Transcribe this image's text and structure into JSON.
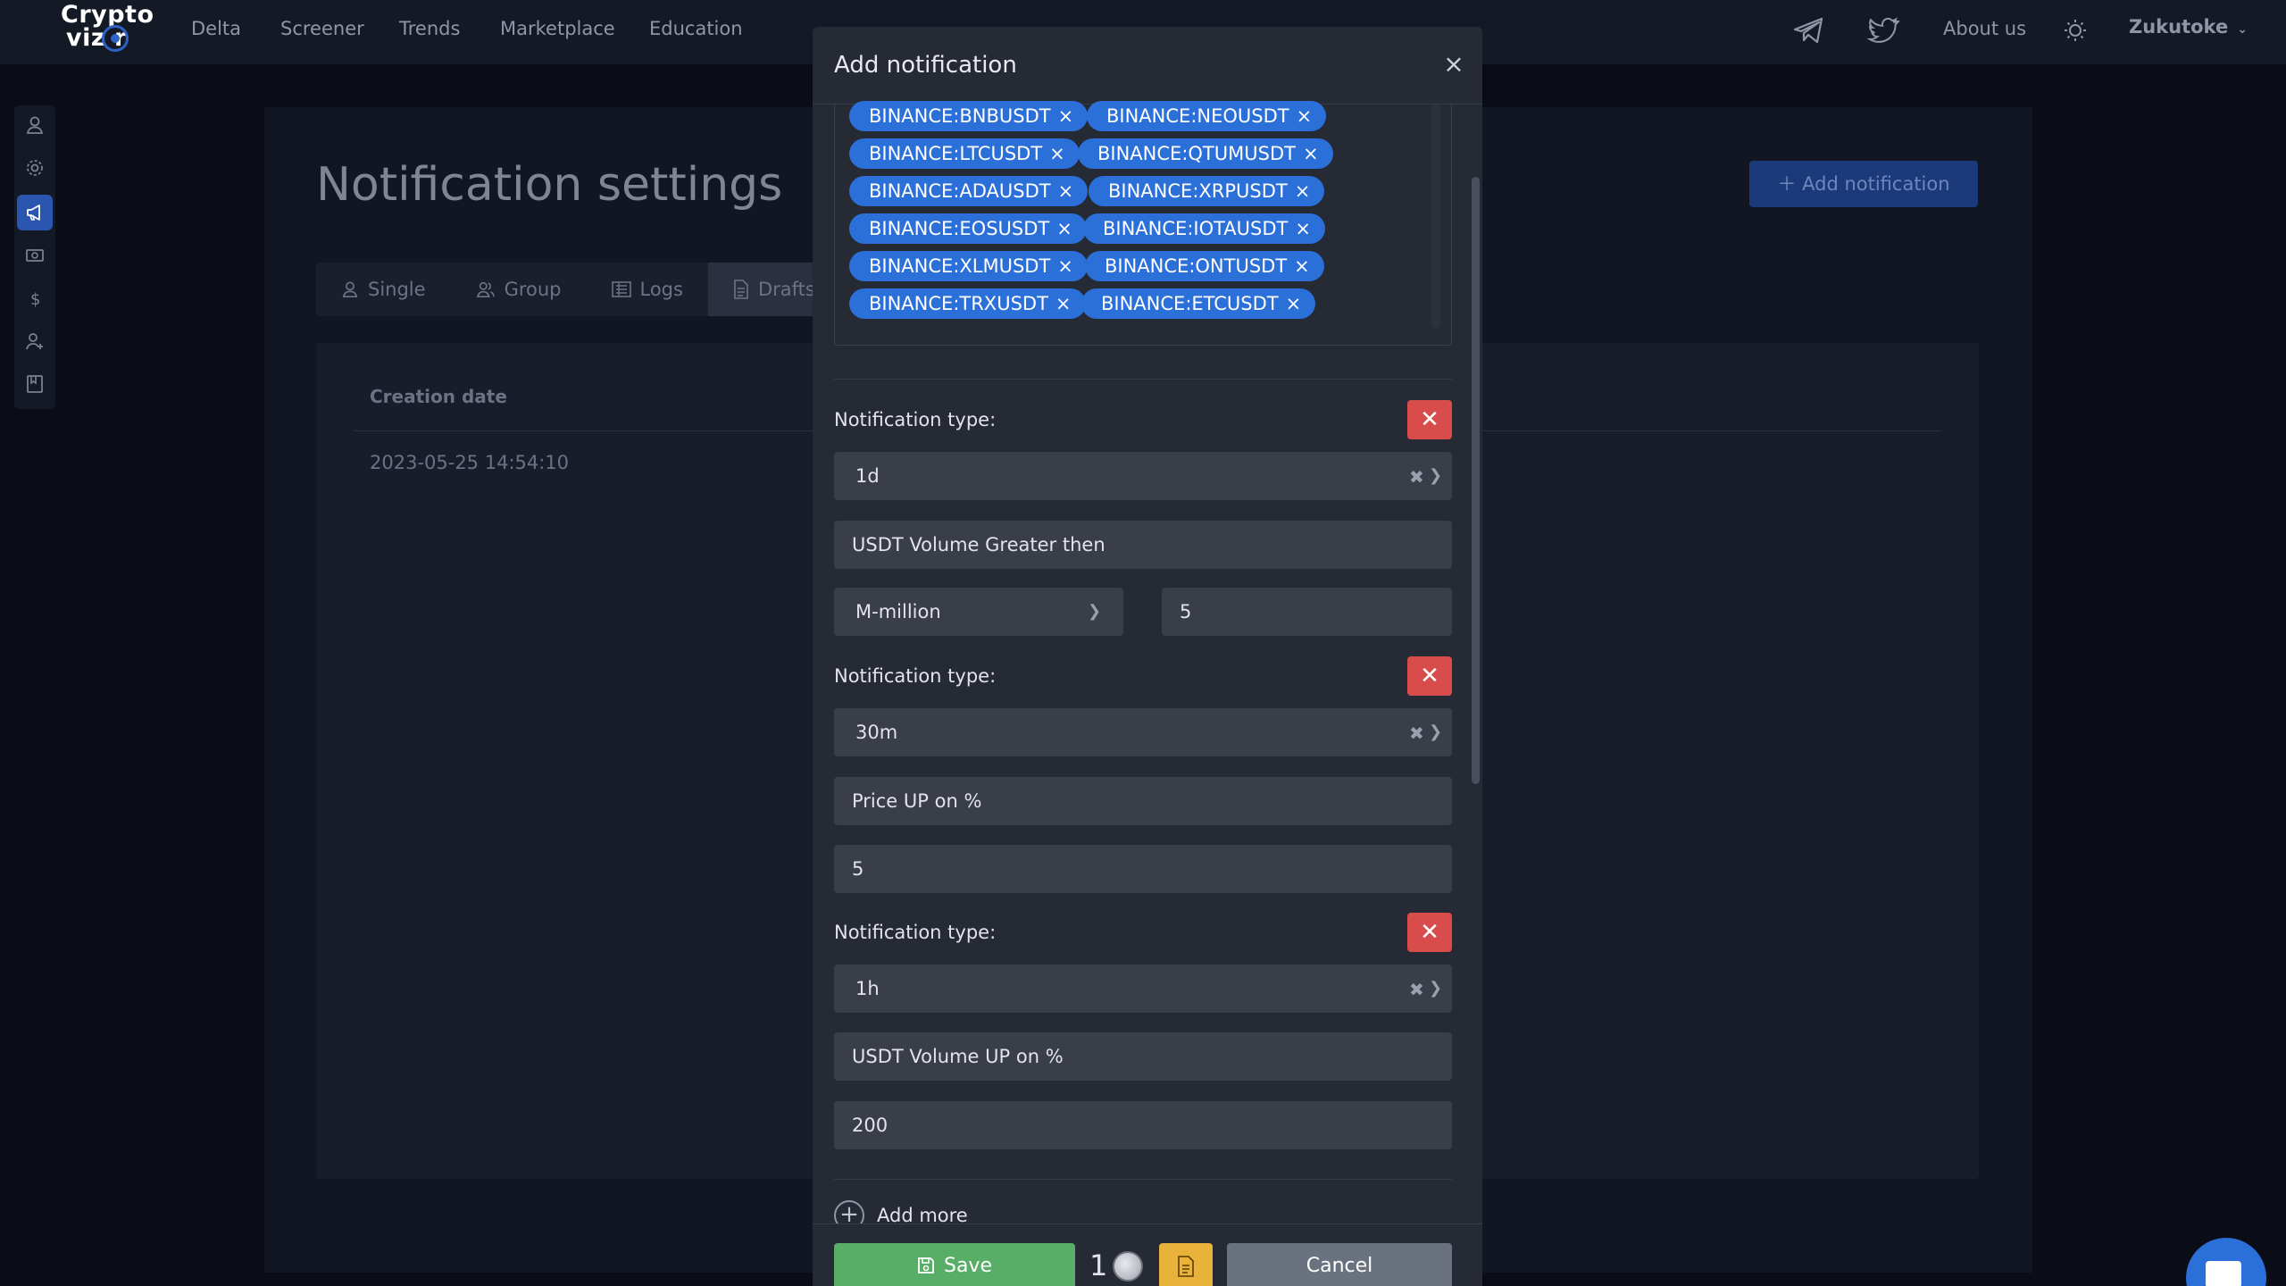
{
  "navbar": {
    "logo_line1": "Crypto",
    "logo_line2": "viz r",
    "links": [
      "Delta",
      "Screener",
      "Trends",
      "Marketplace",
      "Education"
    ],
    "about": "About us",
    "user": "Zukutoke"
  },
  "page": {
    "title": "Notification settings",
    "add_button": "Add notification",
    "tabs": [
      "Single",
      "Group",
      "Logs",
      "Drafts"
    ],
    "active_tab": "Drafts",
    "table": {
      "header": "Creation date",
      "rows": [
        "2023-05-25 14:54:10"
      ]
    }
  },
  "modal": {
    "title": "Add notification",
    "tags": [
      "BINANCE:BNBUSDT",
      "BINANCE:NEOUSDT",
      "BINANCE:LTCUSDT",
      "BINANCE:QTUMUSDT",
      "BINANCE:ADAUSDT",
      "BINANCE:XRPUSDT",
      "BINANCE:EOSUSDT",
      "BINANCE:IOTAUSDT",
      "BINANCE:XLMUSDT",
      "BINANCE:ONTUSDT",
      "BINANCE:TRXUSDT",
      "BINANCE:ETCUSDT"
    ],
    "notifications": [
      {
        "label": "Notification type:",
        "interval": "1d",
        "condition": "USDT Volume Greater then",
        "unit": "M-million",
        "value": "5"
      },
      {
        "label": "Notification type:",
        "interval": "30m",
        "condition": "Price UP on %",
        "value": "5"
      },
      {
        "label": "Notification type:",
        "interval": "1h",
        "condition": "USDT Volume UP on %",
        "value": "200"
      }
    ],
    "add_more": "Add more",
    "save": "Save",
    "counter": "1",
    "cancel": "Cancel"
  },
  "colors": {
    "tag_bg": "#2b6fd9",
    "save_bg": "#58ad67",
    "delete_bg": "#d94c4c",
    "draft_bg": "#e8b23b",
    "cancel_bg": "#6a717f"
  }
}
